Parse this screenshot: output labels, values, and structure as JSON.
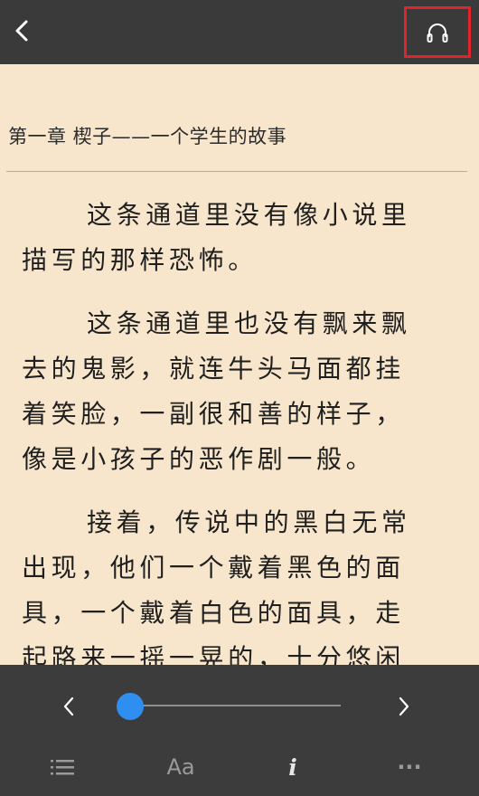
{
  "topbar": {
    "back_icon": "chevron-left-icon",
    "audio_icon": "headphones-icon",
    "highlight_color": "#e3232a"
  },
  "chapter": {
    "title": "第一章 楔子——一个学生的故事"
  },
  "paragraphs": [
    "这条通道里没有像小说里描写的那样恐怖。",
    "这条通道里也没有飘来飘去的鬼影，就连牛头马面都挂着笑脸，一副很和善的样子，像是小孩子的恶作剧一般。",
    "接着，传说中的黑白无常出现，他们一个戴着黑色的面具，一个戴着白色的面具，走起路来一摇一晃的，十分悠闲"
  ],
  "progress": {
    "value": 0.0,
    "accent": "#2f8ff0"
  },
  "toolbar": {
    "font_label": "Aa",
    "info_label": "i",
    "more_label": "···",
    "toc_icon": "list-icon"
  },
  "colors": {
    "page_bg": "#f7e6cc",
    "bar_bg": "#3a3a3a"
  }
}
